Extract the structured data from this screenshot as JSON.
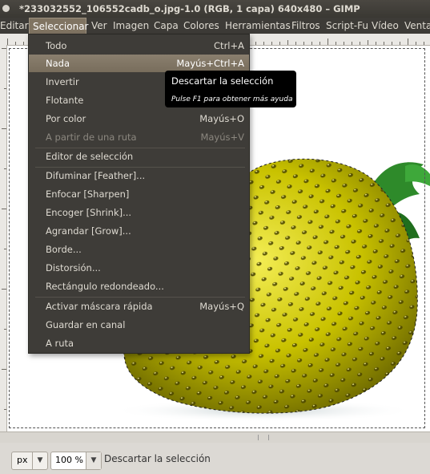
{
  "window": {
    "title": "*233032552_106552cadb_o.jpg-1.0 (RGB, 1 capa) 640x480 – GIMP"
  },
  "menubar": {
    "items": [
      {
        "label": "Editar"
      },
      {
        "label": "Seleccionar"
      },
      {
        "label": "Ver"
      },
      {
        "label": "Imagen"
      },
      {
        "label": "Capa"
      },
      {
        "label": "Colores"
      },
      {
        "label": "Herramientas"
      },
      {
        "label": "Filtros"
      },
      {
        "label": "Script-Fu"
      },
      {
        "label": "Vídeo"
      },
      {
        "label": "Venta"
      }
    ],
    "active": "Seleccionar"
  },
  "menu": {
    "items": [
      {
        "label": "Todo",
        "accel": "Ctrl+A"
      },
      {
        "label": "Nada",
        "accel": "Mayús+Ctrl+A"
      },
      {
        "label": "Invertir",
        "accel": ""
      },
      {
        "label": "Flotante",
        "accel": ""
      },
      {
        "label": "Por color",
        "accel": "Mayús+O"
      },
      {
        "label": "A partir de una ruta",
        "accel": "Mayús+V"
      },
      {
        "label": "Editor de selección",
        "accel": ""
      },
      {
        "label": "Difuminar [Feather]...",
        "accel": ""
      },
      {
        "label": "Enfocar [Sharpen]",
        "accel": ""
      },
      {
        "label": "Encoger [Shrink]...",
        "accel": ""
      },
      {
        "label": "Agrandar [Grow]...",
        "accel": ""
      },
      {
        "label": "Borde...",
        "accel": ""
      },
      {
        "label": "Distorsión...",
        "accel": ""
      },
      {
        "label": "Rectángulo redondeado...",
        "accel": ""
      },
      {
        "label": "Activar máscara rápida",
        "accel": "Mayús+Q"
      },
      {
        "label": "Guardar en canal",
        "accel": ""
      },
      {
        "label": "A ruta",
        "accel": ""
      }
    ],
    "highlighted": "Nada",
    "disabled": "A partir de una ruta"
  },
  "tooltip": {
    "title": "Descartar la selección",
    "hint": "Pulse F1 para obtener más ayuda"
  },
  "statusbar": {
    "unit": "px",
    "zoom": "100 %",
    "message": "Descartar la selección"
  },
  "colors": {
    "menu_bg": "#3e3c38",
    "highlight": "#807462",
    "fruit": "#c9c200",
    "leaf": "#2e8a2a"
  },
  "icons": {
    "dropdown": "triangle-down"
  }
}
